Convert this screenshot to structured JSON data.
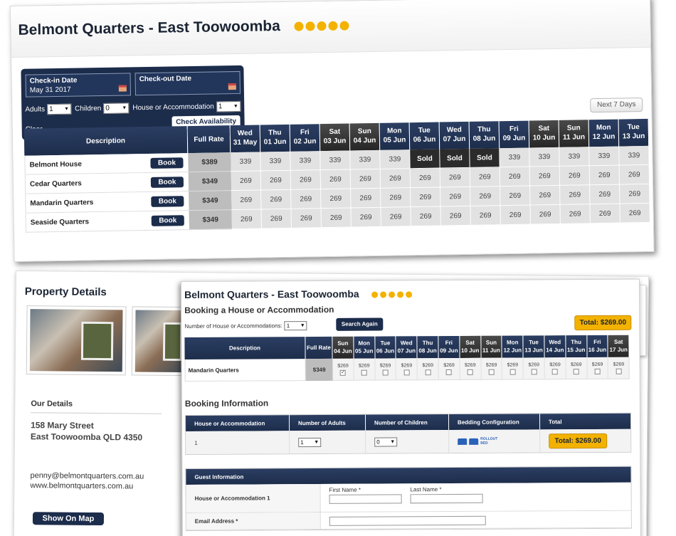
{
  "property": {
    "name": "Belmont Quarters - East Toowoomba",
    "star_count": 5
  },
  "search": {
    "checkin_label": "Check-in Date",
    "checkin_value": "May 31 2017",
    "checkout_label": "Check-out Date",
    "checkout_value": "",
    "adults_label": "Adults",
    "adults_value": "1",
    "children_label": "Children",
    "children_value": "0",
    "house_label": "House or Accommodation",
    "house_value": "1",
    "clear_label": "Clear",
    "check_label": "Check Availability",
    "next_label": "Next 7 Days"
  },
  "availability": {
    "desc_header": "Description",
    "rate_header": "Full Rate",
    "book_label": "Book",
    "days": [
      {
        "dow": "Wed",
        "date": "31 May",
        "weekend": false
      },
      {
        "dow": "Thu",
        "date": "01 Jun",
        "weekend": false
      },
      {
        "dow": "Fri",
        "date": "02 Jun",
        "weekend": false
      },
      {
        "dow": "Sat",
        "date": "03 Jun",
        "weekend": true
      },
      {
        "dow": "Sun",
        "date": "04 Jun",
        "weekend": true
      },
      {
        "dow": "Mon",
        "date": "05 Jun",
        "weekend": false
      },
      {
        "dow": "Tue",
        "date": "06 Jun",
        "weekend": false
      },
      {
        "dow": "Wed",
        "date": "07 Jun",
        "weekend": false
      },
      {
        "dow": "Thu",
        "date": "08 Jun",
        "weekend": false
      },
      {
        "dow": "Fri",
        "date": "09 Jun",
        "weekend": false
      },
      {
        "dow": "Sat",
        "date": "10 Jun",
        "weekend": true
      },
      {
        "dow": "Sun",
        "date": "11 Jun",
        "weekend": true
      },
      {
        "dow": "Mon",
        "date": "12 Jun",
        "weekend": false
      },
      {
        "dow": "Tue",
        "date": "13 Jun",
        "weekend": false
      }
    ],
    "rooms": [
      {
        "name": "Belmont House",
        "rate": "$389",
        "cells": [
          "339",
          "339",
          "339",
          "339",
          "339",
          "339",
          "Sold",
          "Sold",
          "Sold",
          "339",
          "339",
          "339",
          "339",
          "339"
        ]
      },
      {
        "name": "Cedar Quarters",
        "rate": "$349",
        "cells": [
          "269",
          "269",
          "269",
          "269",
          "269",
          "269",
          "269",
          "269",
          "269",
          "269",
          "269",
          "269",
          "269",
          "269"
        ]
      },
      {
        "name": "Mandarin Quarters",
        "rate": "$349",
        "cells": [
          "269",
          "269",
          "269",
          "269",
          "269",
          "269",
          "269",
          "269",
          "269",
          "269",
          "269",
          "269",
          "269",
          "269"
        ]
      },
      {
        "name": "Seaside Quarters",
        "rate": "$349",
        "cells": [
          "269",
          "269",
          "269",
          "269",
          "269",
          "269",
          "269",
          "269",
          "269",
          "269",
          "269",
          "269",
          "269",
          "269"
        ]
      }
    ]
  },
  "details": {
    "title": "Property Details",
    "our_details": "Our Details",
    "address_line1": "158 Mary Street",
    "address_line2": "East Toowoomba QLD 4350",
    "email": "penny@belmontquarters.com.au",
    "website": "www.belmontquarters.com.au",
    "map_label": "Show On Map"
  },
  "booking": {
    "subtitle": "Booking a House or Accommodation",
    "number_label": "Number of House or Accommodations:",
    "number_value": "1",
    "search_again": "Search Again",
    "total": "Total: $269.00",
    "room_name": "Mandarin Quarters",
    "room_rate": "$349",
    "days": [
      {
        "dow": "Sun",
        "date": "04 Jun",
        "weekend": true,
        "price": "$269",
        "checked": true
      },
      {
        "dow": "Mon",
        "date": "05 Jun",
        "weekend": false,
        "price": "$269",
        "checked": false
      },
      {
        "dow": "Tue",
        "date": "06 Jun",
        "weekend": false,
        "price": "$269",
        "checked": false
      },
      {
        "dow": "Wed",
        "date": "07 Jun",
        "weekend": false,
        "price": "$269",
        "checked": false
      },
      {
        "dow": "Thu",
        "date": "08 Jun",
        "weekend": false,
        "price": "$269",
        "checked": false
      },
      {
        "dow": "Fri",
        "date": "09 Jun",
        "weekend": false,
        "price": "$269",
        "checked": false
      },
      {
        "dow": "Sat",
        "date": "10 Jun",
        "weekend": true,
        "price": "$269",
        "checked": false
      },
      {
        "dow": "Sun",
        "date": "11 Jun",
        "weekend": true,
        "price": "$269",
        "checked": false
      },
      {
        "dow": "Mon",
        "date": "12 Jun",
        "weekend": false,
        "price": "$269",
        "checked": false
      },
      {
        "dow": "Tue",
        "date": "13 Jun",
        "weekend": false,
        "price": "$269",
        "checked": false
      },
      {
        "dow": "Wed",
        "date": "14 Jun",
        "weekend": false,
        "price": "$269",
        "checked": false
      },
      {
        "dow": "Thu",
        "date": "15 Jun",
        "weekend": false,
        "price": "$269",
        "checked": false
      },
      {
        "dow": "Fri",
        "date": "16 Jun",
        "weekend": false,
        "price": "$269",
        "checked": false
      },
      {
        "dow": "Sat",
        "date": "17 Jun",
        "weekend": true,
        "price": "$269",
        "checked": false
      }
    ],
    "info_title": "Booking Information",
    "info_headers": [
      "House or Accommodation",
      "Number of Adults",
      "Number of Children",
      "Bedding Configuration",
      "Total"
    ],
    "info_row": {
      "house": "1",
      "adults": "1",
      "children": "0",
      "rollout": "ROLLOUT BED",
      "total": "Total: $269.00"
    },
    "guest_title": "Guest Information",
    "guest_house_label": "House or Accommodation 1",
    "first_name_label": "First Name *",
    "last_name_label": "Last Name *",
    "email_label": "Email Address *"
  },
  "colors": {
    "navy": "#1c2c4b",
    "gold": "#f3b200",
    "sold": "#2b2b2b"
  }
}
